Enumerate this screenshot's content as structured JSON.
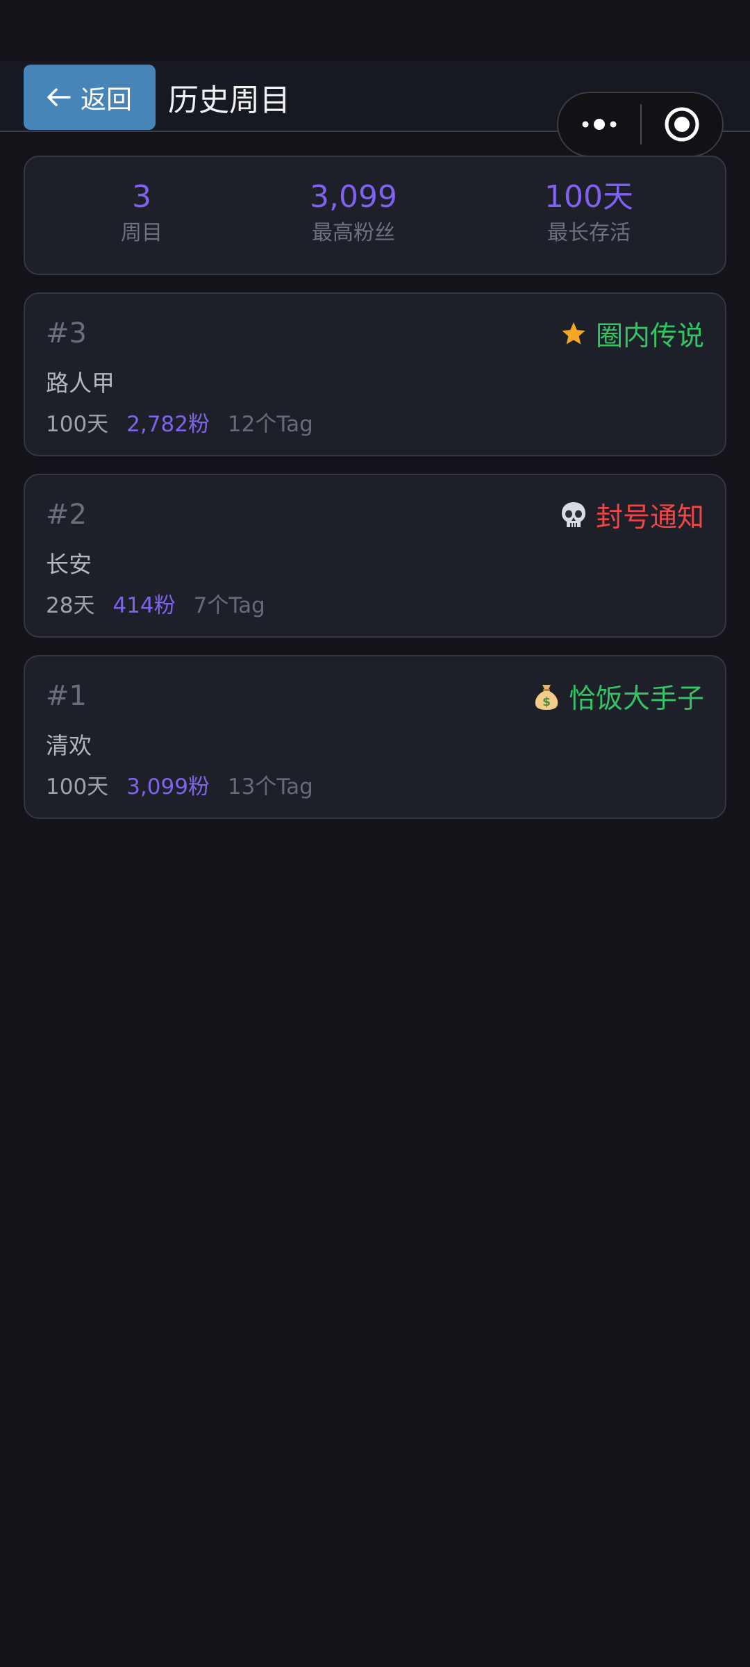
{
  "header": {
    "back_label": "返回",
    "title": "历史周目"
  },
  "summary": {
    "runs_value": "3",
    "runs_label": "周目",
    "max_fans_value": "3,099",
    "max_fans_label": "最高粉丝",
    "longest_survival_value": "100天",
    "longest_survival_label": "最长存活"
  },
  "runs": [
    {
      "number": "#3",
      "name": "路人甲",
      "days": "100天",
      "fans": "2,782粉",
      "tags": "12个Tag",
      "ending_icon": "star-icon",
      "ending_label": "圈内传说",
      "ending_color": "#34c463"
    },
    {
      "number": "#2",
      "name": "长安",
      "days": "28天",
      "fans": "414粉",
      "tags": "7个Tag",
      "ending_icon": "skull-icon",
      "ending_label": "封号通知",
      "ending_color": "#ef4747"
    },
    {
      "number": "#1",
      "name": "清欢",
      "days": "100天",
      "fans": "3,099粉",
      "tags": "13个Tag",
      "ending_icon": "money-bag-icon",
      "ending_label": "恰饭大手子",
      "ending_color": "#34c463"
    }
  ],
  "colors": {
    "accent": "#8061f0",
    "back_button": "#4784b8",
    "background": "#131319",
    "card": "#1e2029"
  }
}
